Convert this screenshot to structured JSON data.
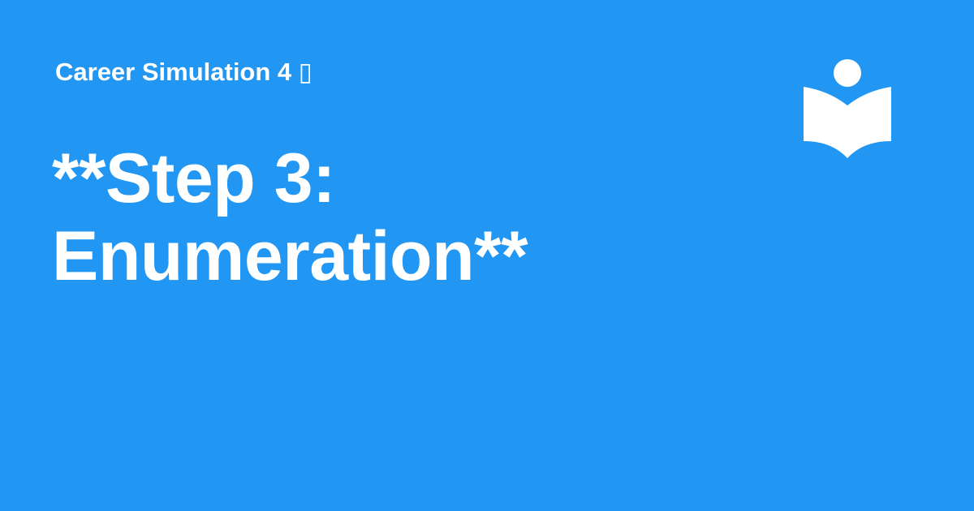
{
  "header": {
    "subtitle": "Career Simulation 4 ▯"
  },
  "main": {
    "title": "**Step 3: Enumeration**"
  },
  "branding": {
    "logo_icon": "reading-person-book-icon",
    "background_color": "#2196F3",
    "foreground_color": "#FFFFFF"
  }
}
